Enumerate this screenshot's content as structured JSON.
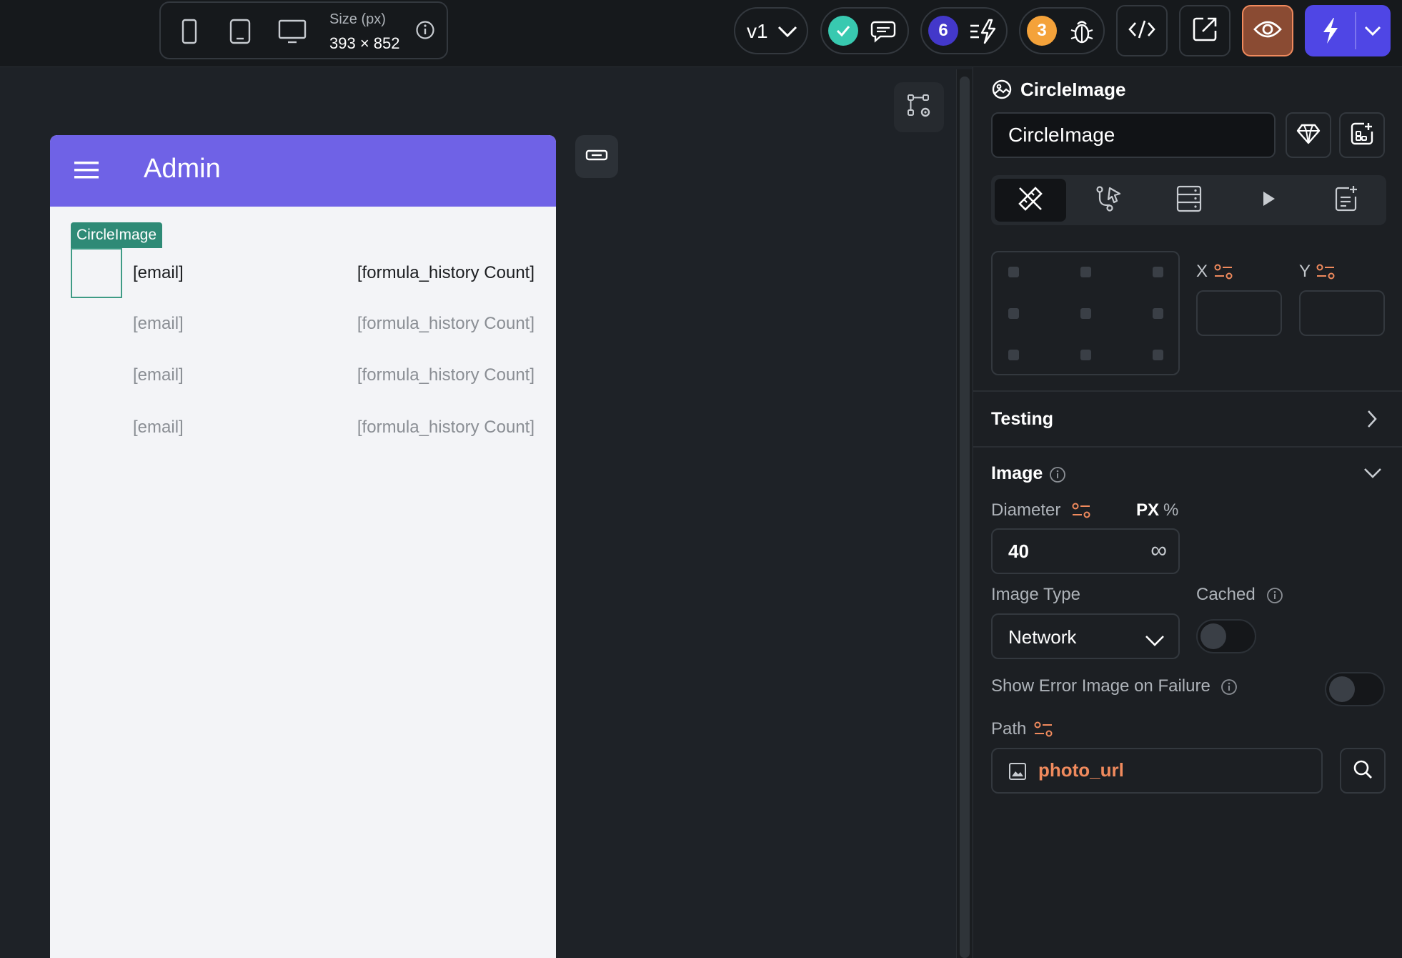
{
  "topbar": {
    "size_label": "Size (px)",
    "size_value": "393 × 852",
    "version": "v1",
    "comments_count": "6",
    "bugs_count": "3",
    "colors": {
      "accent": "#4f46e5",
      "preview_border": "#f08a5d",
      "success": "#38c9b0",
      "warning": "#f4a23a"
    }
  },
  "phone": {
    "appbar_title": "Admin",
    "selected_tag": "CircleImage",
    "rows": [
      {
        "email": "[email]",
        "count": "[formula_history Count]"
      },
      {
        "email": "[email]",
        "count": "[formula_history Count]"
      },
      {
        "email": "[email]",
        "count": "[formula_history Count]"
      },
      {
        "email": "[email]",
        "count": "[formula_history Count]"
      }
    ],
    "appbar_color": "#6f62e6"
  },
  "panel": {
    "title": "CircleImage",
    "name_value": "CircleImage",
    "x_label": "X",
    "y_label": "Y",
    "testing_title": "Testing",
    "image_section_title": "Image",
    "diameter_label": "Diameter",
    "unit_px": "PX",
    "unit_percent": "%",
    "diameter_value": "40",
    "infinity_symbol": "∞",
    "image_type_label": "Image Type",
    "image_type_value": "Network",
    "cached_label": "Cached",
    "show_error_label": "Show Error Image on Failure",
    "path_label": "Path",
    "path_value": "photo_url"
  }
}
